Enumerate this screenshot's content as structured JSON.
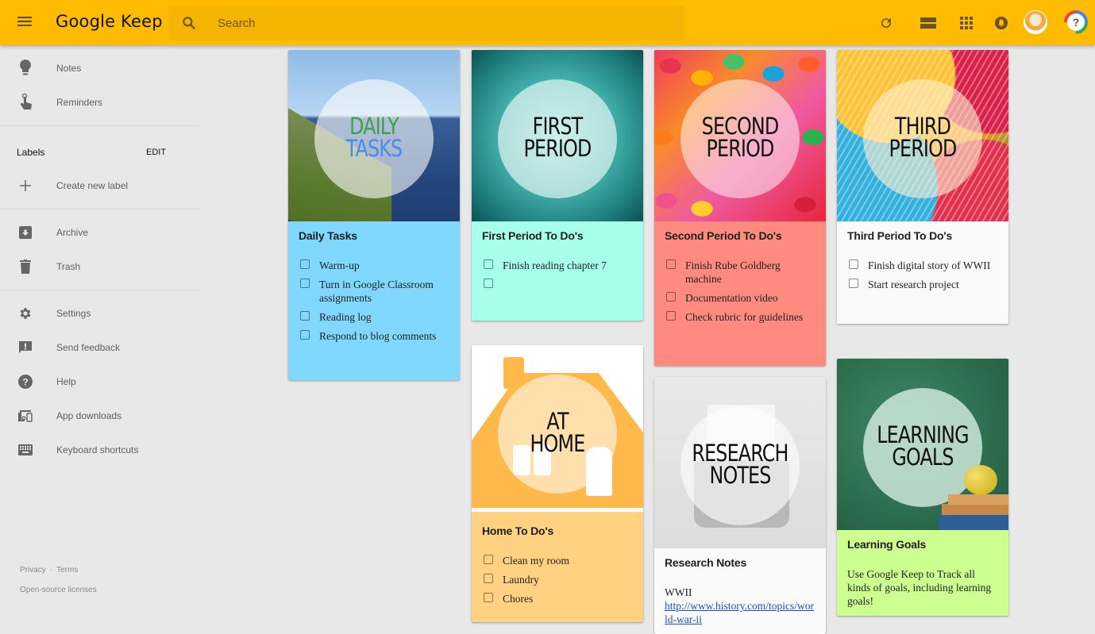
{
  "app": {
    "title": "Google Keep",
    "search_placeholder": "Search",
    "toolbar_icons": [
      "refresh-icon",
      "list-view-icon",
      "apps-grid-icon",
      "notifications-bell-icon",
      "account-avatar",
      "help-icon"
    ]
  },
  "sidebar": {
    "top_items": [
      {
        "label": "Notes",
        "icon": "lightbulb-icon"
      },
      {
        "label": "Reminders",
        "icon": "reminder-finger-icon"
      }
    ],
    "labels_header": "Labels",
    "labels_edit": "EDIT",
    "create_label": {
      "label": "Create new label",
      "icon": "plus-icon"
    },
    "mid_items": [
      {
        "label": "Archive",
        "icon": "archive-icon"
      },
      {
        "label": "Trash",
        "icon": "trash-icon"
      }
    ],
    "bottom_items": [
      {
        "label": "Settings",
        "icon": "gear-icon"
      },
      {
        "label": "Send feedback",
        "icon": "feedback-icon"
      },
      {
        "label": "Help",
        "icon": "help-circle-icon"
      },
      {
        "label": "App downloads",
        "icon": "devices-icon"
      },
      {
        "label": "Keyboard shortcuts",
        "icon": "keyboard-icon"
      }
    ],
    "footer": {
      "privacy": "Privacy",
      "separator": "·",
      "terms": "Terms",
      "open_source": "Open-source licenses"
    }
  },
  "notes": [
    {
      "image_text": [
        "DAILY",
        "TASKS"
      ],
      "title": "Daily Tasks",
      "color": "#80d8ff",
      "items": [
        "Warm-up",
        "Turn in Google Classroom assignments",
        "Reading log",
        "Respond to blog comments"
      ]
    },
    {
      "image_text": [
        "FIRST",
        "PERIOD"
      ],
      "title": "First Period To Do's",
      "color": "#a7ffeb",
      "items": [
        "Finish reading chapter 7",
        ""
      ]
    },
    {
      "image_text": [
        "SECOND",
        "PERIOD"
      ],
      "title": "Second Period To Do's",
      "color": "#ff8a80",
      "items": [
        "Finish Rube Goldberg machine",
        "Documentation video",
        "Check rubric for guidelines"
      ]
    },
    {
      "image_text": [
        "THIRD",
        "PERIOD"
      ],
      "title": "Third Period To Do's",
      "color": "#fafafa",
      "items": [
        "Finish digital story of WWII",
        "Start research project"
      ]
    },
    {
      "image_text": [
        "AT",
        "HOME"
      ],
      "title": "Home To Do's",
      "color": "#ffd180",
      "items": [
        "Clean my room",
        "Laundry",
        "Chores"
      ]
    },
    {
      "image_text": [
        "RESEARCH",
        "NOTES"
      ],
      "title": "Research Notes",
      "color": "#fafafa",
      "body_text": "WWII",
      "link": "http://www.history.com/topics/world-war-ii"
    },
    {
      "image_text": [
        "LEARNING",
        "GOALS"
      ],
      "title": "Learning Goals",
      "color": "#ccff90",
      "body_text": "Use Google Keep to Track all kinds of goals, including learning goals!"
    }
  ]
}
